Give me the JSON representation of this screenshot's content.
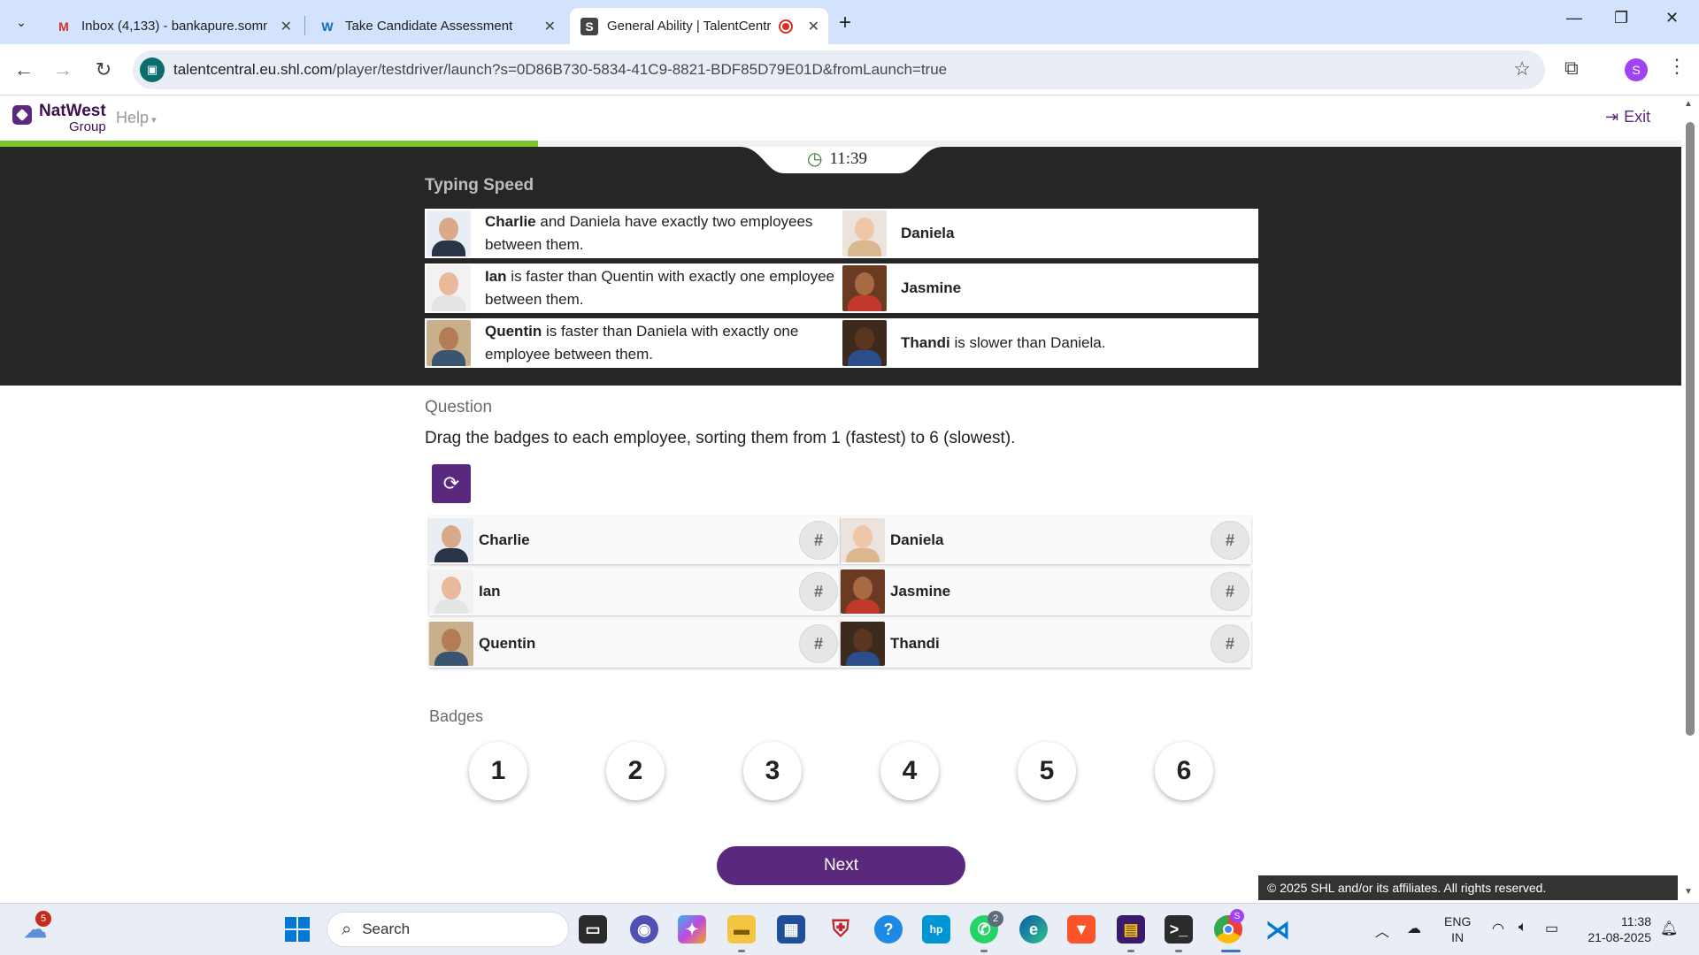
{
  "browser": {
    "tabs": [
      {
        "title": "Inbox (4,133) - bankapure.somn",
        "icon": "gmail-icon"
      },
      {
        "title": "Take Candidate Assessment",
        "icon": "w-icon"
      },
      {
        "title": "General Ability | TalentCentr",
        "icon": "shl-icon",
        "active": true
      }
    ],
    "url_host": "talentcentral.eu.shl.com",
    "url_path": "/player/testdriver/launch?s=0D86B730-5834-41C9-8821-BDF85D79E01D&fromLaunch=true",
    "profile_initial": "S"
  },
  "header": {
    "brand_line1": "NatWest",
    "brand_line2": "Group",
    "help_label": "Help",
    "exit_label": "Exit",
    "progress_fraction": 0.32,
    "timer": "11:39"
  },
  "clues": {
    "title": "Typing Speed",
    "rows": [
      {
        "left": {
          "name": "Charlie",
          "text": " and Daniela have exactly two employees between them."
        },
        "right": {
          "name": "Daniela",
          "text": ""
        }
      },
      {
        "left": {
          "name": "Ian",
          "text": " is faster than Quentin with exactly one employee between them."
        },
        "right": {
          "name": "Jasmine",
          "text": ""
        }
      },
      {
        "left": {
          "name": "Quentin",
          "text": " is faster than Daniela with exactly one employee between them."
        },
        "right": {
          "name": "Thandi",
          "text": " is slower than Daniela."
        }
      }
    ]
  },
  "question": {
    "title": "Question",
    "text": "Drag the badges to each employee, sorting them from 1 (fastest) to 6 (slowest).",
    "slot_placeholder": "#",
    "employees": [
      "Charlie",
      "Daniela",
      "Ian",
      "Jasmine",
      "Quentin",
      "Thandi"
    ]
  },
  "badges": {
    "title": "Badges",
    "values": [
      "1",
      "2",
      "3",
      "4",
      "5",
      "6"
    ]
  },
  "next_label": "Next",
  "copyright": "© 2025 SHL and/or its affiliates. All rights reserved.",
  "taskbar": {
    "search_placeholder": "Search",
    "weather_badge": "5",
    "whatsapp_badge": "2",
    "chrome_badge": "S",
    "lang_line1": "ENG",
    "lang_line2": "IN",
    "time": "11:38",
    "date": "21-08-2025"
  },
  "colors": {
    "brand_purple": "#5a287d",
    "progress_green": "#7dc42b",
    "dark_band": "#262626"
  }
}
